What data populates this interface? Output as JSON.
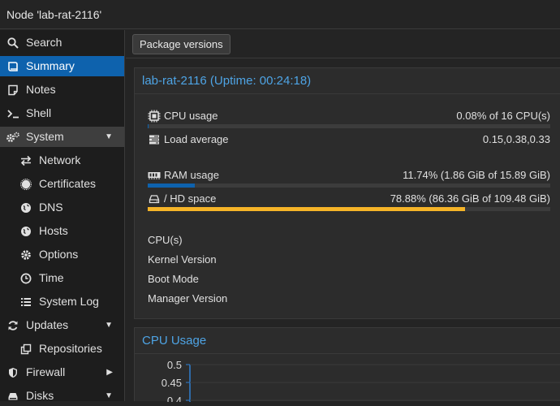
{
  "window": {
    "title": "Node 'lab-rat-2116'"
  },
  "sidebar": {
    "items": [
      {
        "label": "Search"
      },
      {
        "label": "Summary"
      },
      {
        "label": "Notes"
      },
      {
        "label": "Shell"
      },
      {
        "label": "System"
      },
      {
        "label": "Network"
      },
      {
        "label": "Certificates"
      },
      {
        "label": "DNS"
      },
      {
        "label": "Hosts"
      },
      {
        "label": "Options"
      },
      {
        "label": "Time"
      },
      {
        "label": "System Log"
      },
      {
        "label": "Updates"
      },
      {
        "label": "Repositories"
      },
      {
        "label": "Firewall"
      },
      {
        "label": "Disks"
      }
    ],
    "active": "Summary",
    "accent": "#0e62ad"
  },
  "toolbar": {
    "package_versions_label": "Package versions"
  },
  "status_panel": {
    "title": "lab-rat-2116 (Uptime: 00:24:18)",
    "cpu": {
      "label": "CPU usage",
      "value": "0.08% of 16 CPU(s)",
      "fraction": 0.0008
    },
    "load": {
      "label": "Load average",
      "value": "0.15,0.38,0.33"
    },
    "ram": {
      "label": "RAM usage",
      "value": "11.74% (1.86 GiB of 15.89 GiB)",
      "fraction": 0.1174,
      "color": "#0e62ad"
    },
    "hd": {
      "label": "/ HD space",
      "value": "78.88% (86.36 GiB of 109.48 GiB)",
      "fraction": 0.7888,
      "color": "#f5b428"
    },
    "info": [
      "CPU(s)",
      "Kernel Version",
      "Boot Mode",
      "Manager Version"
    ]
  },
  "cpu_panel": {
    "title": "CPU Usage",
    "chart_data": {
      "type": "line",
      "title": "CPU Usage",
      "yticks": [
        "0.5",
        "0.45",
        "0.4"
      ],
      "ylim": [
        0.4,
        0.5
      ],
      "series": []
    }
  }
}
